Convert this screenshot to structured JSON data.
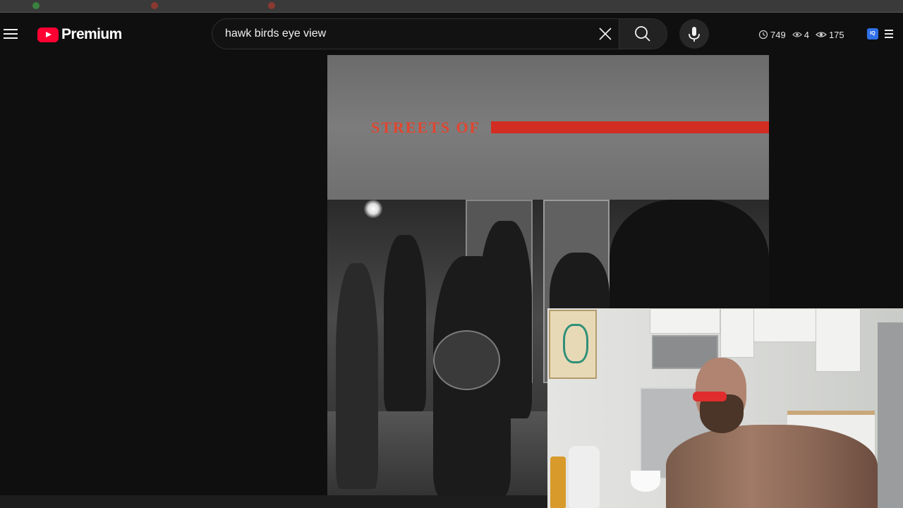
{
  "header": {
    "brand": "Premium",
    "search": {
      "value": "hawk birds eye view"
    }
  },
  "extension": {
    "stats": [
      {
        "icon": "clock-icon",
        "value": "749"
      },
      {
        "icon": "eye-outline-icon",
        "value": "4"
      },
      {
        "icon": "eye-icon",
        "value": "175"
      }
    ],
    "badge": "IQ"
  },
  "video": {
    "overlay_title": "STREETS OF",
    "accent_color": "#d22d22"
  },
  "colors": {
    "background": "#0f0f0f",
    "youtube_red": "#ff0033"
  }
}
